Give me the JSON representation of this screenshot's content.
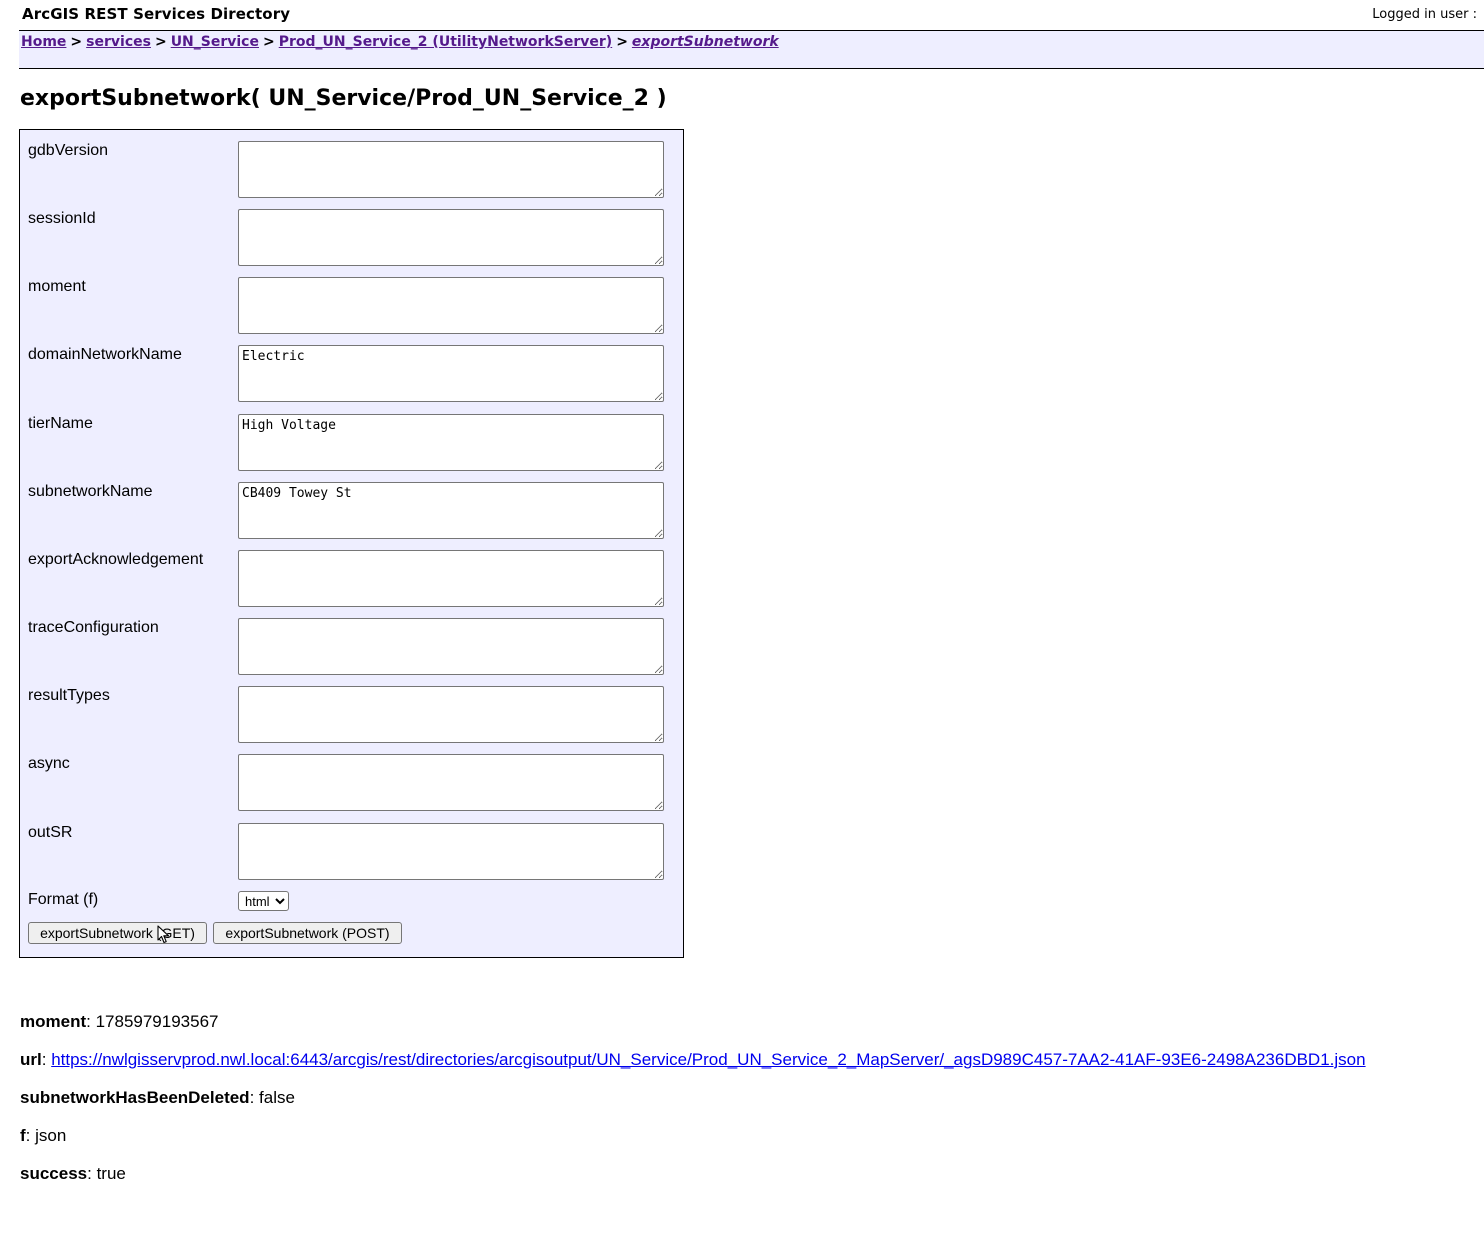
{
  "header": {
    "app_title": "ArcGIS REST Services Directory",
    "login_text": "Logged in user :"
  },
  "breadcrumb": {
    "items": [
      "Home",
      "services",
      "UN_Service",
      "Prod_UN_Service_2 (UtilityNetworkServer)"
    ],
    "current": "exportSubnetwork",
    "separator": ">"
  },
  "page": {
    "title": "exportSubnetwork( UN_Service/Prod_UN_Service_2 )"
  },
  "form": {
    "fields": [
      {
        "label": "gdbVersion",
        "value": ""
      },
      {
        "label": "sessionId",
        "value": ""
      },
      {
        "label": "moment",
        "value": ""
      },
      {
        "label": "domainNetworkName",
        "value": "Electric"
      },
      {
        "label": "tierName",
        "value": "High Voltage"
      },
      {
        "label": "subnetworkName",
        "value": "CB409 Towey St"
      },
      {
        "label": "exportAcknowledgement",
        "value": ""
      },
      {
        "label": "traceConfiguration",
        "value": ""
      },
      {
        "label": "resultTypes",
        "value": ""
      },
      {
        "label": "async",
        "value": ""
      },
      {
        "label": "outSR",
        "value": ""
      }
    ],
    "format_label": "Format (f)",
    "format_value": "html",
    "get_button": "exportSubnetwork (GET)",
    "post_button": "exportSubnetwork (POST)"
  },
  "results": {
    "moment_key": "moment",
    "moment_value": "1785979193567",
    "url_key": "url",
    "url_value": "https://nwlgisservprod.nwl.local:6443/arcgis/rest/directories/arcgisoutput/UN_Service/Prod_UN_Service_2_MapServer/_agsD989C457-7AA2-41AF-93E6-2498A236DBD1.json",
    "deleted_key": "subnetworkHasBeenDeleted",
    "deleted_value": "false",
    "f_key": "f",
    "f_value": "json",
    "success_key": "success",
    "success_value": "true"
  }
}
